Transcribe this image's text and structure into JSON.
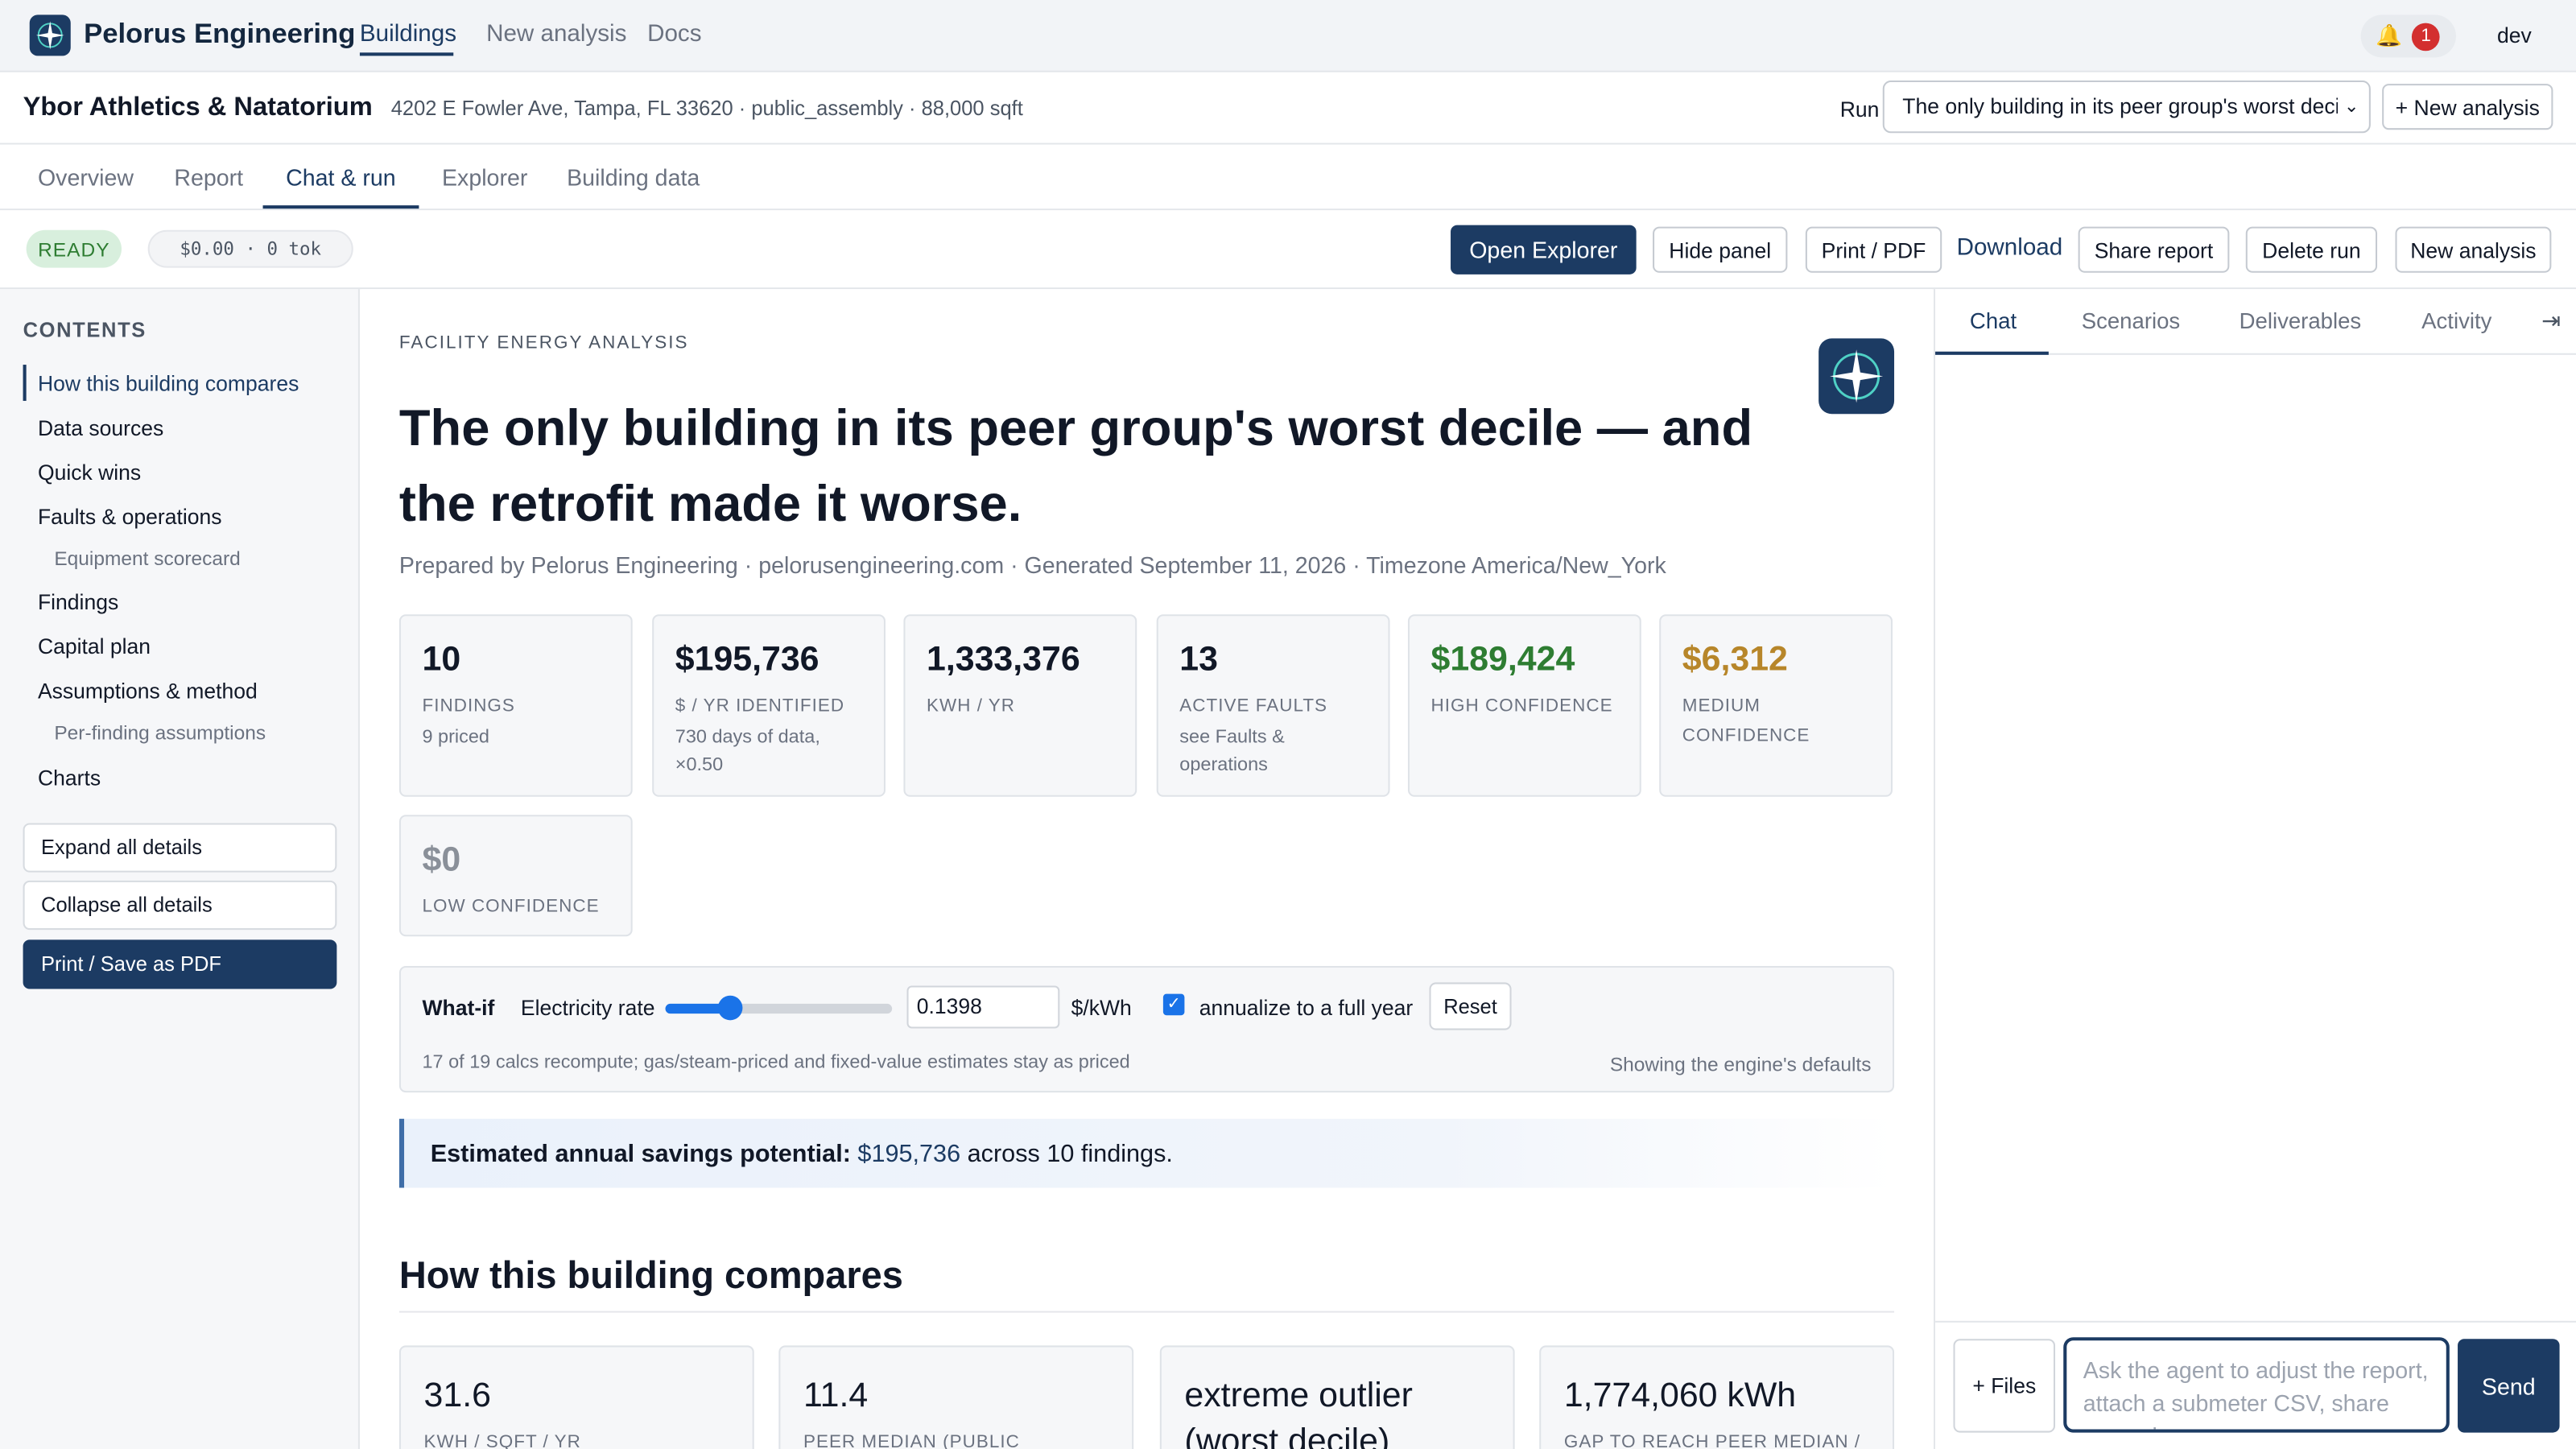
{
  "brand": "Pelorus Engineering",
  "nav": [
    "Buildings",
    "New analysis",
    "Docs"
  ],
  "notifications": {
    "count": "1"
  },
  "user": "dev",
  "building": {
    "name": "Ybor Athletics & Natatorium",
    "address": "4202 E Fowler Ave, Tampa, FL 33620 · public_assembly · 88,000 sqft"
  },
  "run": {
    "label": "Run",
    "selected": "The only building in its peer group's worst deci",
    "new_button": "+ New analysis"
  },
  "tabs": [
    "Overview",
    "Report",
    "Chat & run",
    "Explorer",
    "Building data"
  ],
  "status": {
    "ready": "READY",
    "cost": "$0.00  ·  0 tok"
  },
  "actions": {
    "open_explorer": "Open Explorer",
    "hide_panel": "Hide panel",
    "print_pdf": "Print / PDF",
    "download": "Download",
    "share_report": "Share report",
    "delete_run": "Delete run",
    "new_analysis": "New analysis"
  },
  "sidebar": {
    "title": "CONTENTS",
    "items": [
      {
        "label": "How this building compares"
      },
      {
        "label": "Data sources"
      },
      {
        "label": "Quick wins"
      },
      {
        "label": "Faults & operations"
      },
      {
        "label": "Equipment scorecard"
      },
      {
        "label": "Findings"
      },
      {
        "label": "Capital plan"
      },
      {
        "label": "Assumptions & method"
      },
      {
        "label": "Per-finding assumptions"
      },
      {
        "label": "Charts"
      }
    ],
    "expand": "Expand all details",
    "collapse": "Collapse all details",
    "print": "Print / Save as PDF"
  },
  "report": {
    "eyebrow": "FACILITY ENERGY ANALYSIS",
    "title": "The only building in its peer group's worst decile — and the retrofit made it worse.",
    "prepared": "Prepared by Pelorus Engineering · pelorusengineering.com · Generated September 11, 2026 · Timezone America/New_York",
    "kpis": [
      {
        "value": "10",
        "label": "FINDINGS",
        "sub": "9 priced",
        "color": "#111827"
      },
      {
        "value": "$195,736",
        "label": "$ / YR IDENTIFIED",
        "sub": "730 days of data, ×0.50",
        "color": "#111827"
      },
      {
        "value": "1,333,376",
        "label": "KWH / YR",
        "sub": "",
        "color": "#111827"
      },
      {
        "value": "13",
        "label": "ACTIVE FAULTS",
        "sub": "see Faults & operations",
        "color": "#111827"
      },
      {
        "value": "$189,424",
        "label": "HIGH CONFIDENCE",
        "sub": "",
        "color": "#2e7d32"
      },
      {
        "value": "$6,312",
        "label": "MEDIUM CONFIDENCE",
        "sub": "",
        "color": "#b7862a"
      },
      {
        "value": "$0",
        "label": "LOW CONFIDENCE",
        "sub": "",
        "color": "#8a9099"
      }
    ],
    "whatif": {
      "title": "What-if",
      "label": "Electricity rate",
      "slider_fraction": 0.28,
      "value": "0.1398",
      "unit": "$/kWh",
      "annualize_label": "annualize to a full year",
      "annualize_checked": true,
      "reset": "Reset",
      "note": "17 of 19 calcs recompute; gas/steam-priced and fixed-value estimates stay as priced",
      "defaults": "Showing the engine's defaults"
    },
    "savings": {
      "label": "Estimated annual savings potential:",
      "amount": "$195,736",
      "rest": "across 10 findings."
    },
    "compare": {
      "heading": "How this building compares",
      "cards": [
        {
          "value": "31.6",
          "label": "KWH / SQFT / YR"
        },
        {
          "value": "11.4",
          "label": "PEER MEDIAN (PUBLIC"
        },
        {
          "value": "extreme outlier",
          "label": "(worst decile)"
        },
        {
          "value": "1,774,060 kWh",
          "label": "GAP TO REACH PEER MEDIAN /"
        }
      ]
    }
  },
  "panel": {
    "tabs": [
      "Chat",
      "Scenarios",
      "Deliverables",
      "Activity"
    ],
    "collapse_icon": "collapse-panel-icon",
    "files": "+ Files",
    "placeholder": "Ask the agent to adjust the report, attach a submeter CSV, share scenarios...",
    "send": "Send"
  },
  "colors": {
    "brand": "#1c3b63",
    "high": "#2e7d32",
    "medium": "#b7862a",
    "low": "#8a9099",
    "accent": "#1a73e8"
  }
}
